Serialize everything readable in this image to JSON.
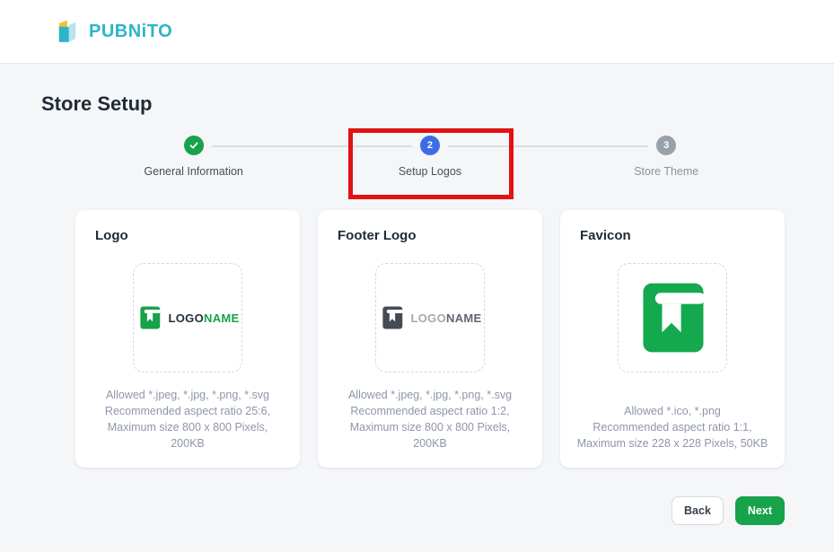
{
  "brand": {
    "name": "PUBNiTO",
    "color": "#2cb5c8"
  },
  "page": {
    "title": "Store Setup"
  },
  "stepper": {
    "steps": [
      {
        "label": "General Information",
        "status": "complete"
      },
      {
        "label": "Setup Logos",
        "status": "active",
        "number": "2"
      },
      {
        "label": "Store Theme",
        "status": "upcoming",
        "number": "3"
      }
    ]
  },
  "annotation": {
    "color": "#e21212",
    "highlights": "Setup Logos step"
  },
  "cards": [
    {
      "title": "Logo",
      "placeholder": {
        "primary": "LOGO",
        "secondary": "NAME"
      },
      "info_lines": [
        "Allowed *.jpeg, *.jpg, *.png, *.svg",
        "Recommended aspect ratio 25:6,",
        "Maximum size 800 x 800 Pixels,",
        "200KB"
      ]
    },
    {
      "title": "Footer Logo",
      "placeholder": {
        "primary": "LOGO",
        "secondary": "NAME"
      },
      "info_lines": [
        "Allowed *.jpeg, *.jpg, *.png, *.svg",
        "Recommended aspect ratio 1:2,",
        "Maximum size 800 x 800 Pixels,",
        "200KB"
      ]
    },
    {
      "title": "Favicon",
      "info_lines": [
        "Allowed *.ico, *.png",
        "Recommended aspect ratio 1:1,",
        "Maximum size 228 x 228 Pixels, 50KB"
      ]
    }
  ],
  "footer": {
    "back_label": "Back",
    "next_label": "Next"
  },
  "colors": {
    "accent_green": "#17a24b",
    "accent_blue": "#3d6de4",
    "inactive_gray": "#98a1ab",
    "brand_teal": "#2cb5c8",
    "annotation_red": "#e21212"
  }
}
